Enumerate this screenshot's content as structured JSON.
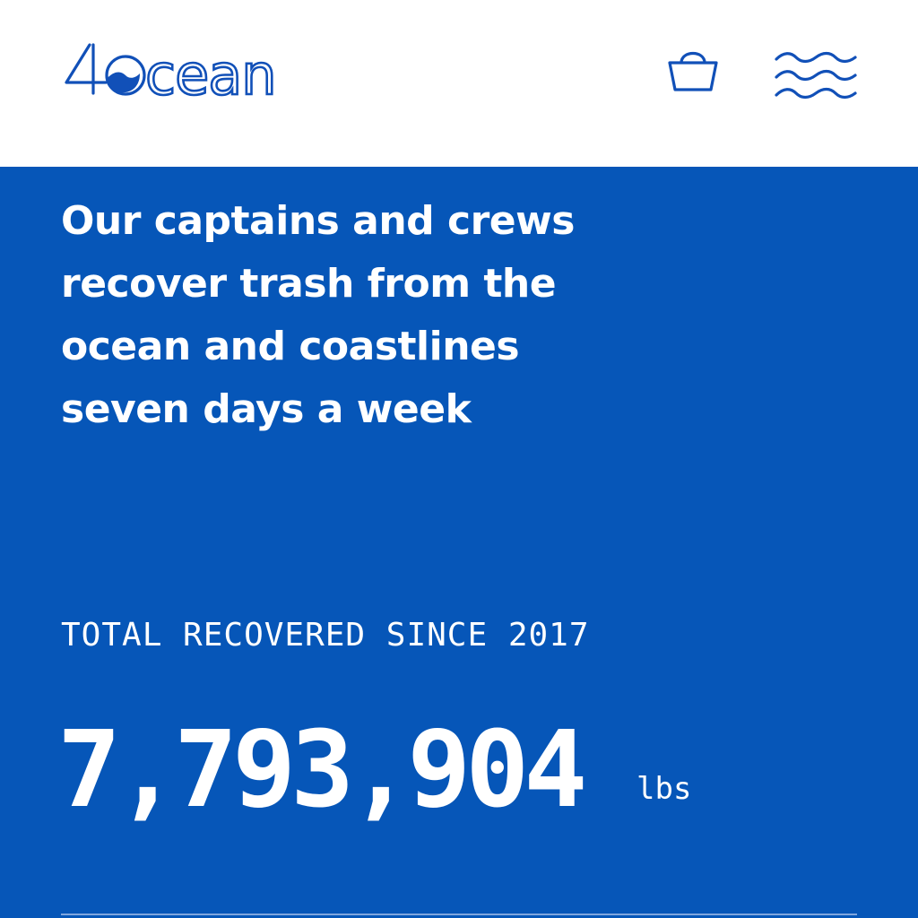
{
  "header": {
    "brand": "4Ocean",
    "basket_icon": "shopping-basket-icon",
    "menu_icon": "waves-menu-icon"
  },
  "hero": {
    "heading": "Our captains and crews recover trash from the ocean and coastlines seven days a week"
  },
  "stats": {
    "label": "TOTAL RECOVERED SINCE 2017",
    "value": "7,793,904",
    "unit": "lbs"
  },
  "colors": {
    "brand_blue": "#0656b8",
    "logo_blue": "#1150b8",
    "text_white": "#ffffff",
    "header_bg": "#ffffff"
  }
}
